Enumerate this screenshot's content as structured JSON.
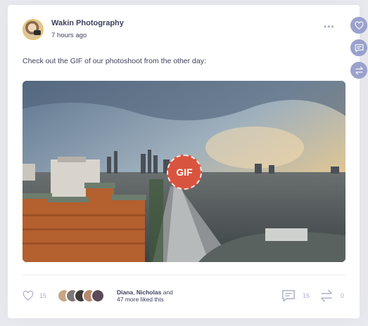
{
  "post": {
    "author": "Wakin Photography",
    "time": "7 hours ago",
    "more_label": "•••",
    "text": "Check out the GIF of our photoshoot from the other day:",
    "media_badge": "GIF"
  },
  "reactions": {
    "likes": "15",
    "likers_names_1": "Diana",
    "likers_sep": ", ",
    "likers_names_2": "Nicholas",
    "likers_and": " and",
    "likers_more": "47 more liked this",
    "comments": "16",
    "shares": "0"
  },
  "side_actions": [
    "heart-icon",
    "comment-icon",
    "share-icon"
  ],
  "colors": {
    "accent": "#d9543f",
    "muted": "#adafca",
    "side": "#9aa2cc"
  }
}
